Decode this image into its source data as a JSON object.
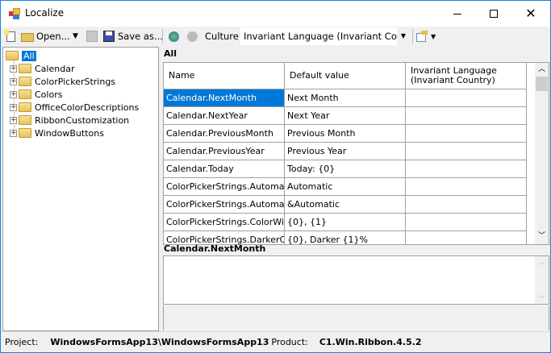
{
  "window": {
    "title": "Localize",
    "controls": [
      "minimize",
      "maximize",
      "close"
    ]
  },
  "toolbar": {
    "open_label": "Open...",
    "save_as_label": "Save as...",
    "culture_label": "Culture",
    "culture_value": "Invariant Language (Invariant Coun"
  },
  "tree": {
    "root": "All",
    "items": [
      "Calendar",
      "ColorPickerStrings",
      "Colors",
      "OfficeColorDescriptions",
      "RibbonCustomization",
      "WindowButtons"
    ]
  },
  "grid": {
    "section_label": "All",
    "headers": [
      "Name",
      "Default value",
      "Invariant Language\n(Invariant Country)"
    ],
    "rows": [
      {
        "name": "Calendar.NextMonth",
        "default": "Next Month",
        "invariant": ""
      },
      {
        "name": "Calendar.NextYear",
        "default": "Next Year",
        "invariant": ""
      },
      {
        "name": "Calendar.PreviousMonth",
        "default": "Previous Month",
        "invariant": ""
      },
      {
        "name": "Calendar.PreviousYear",
        "default": "Previous Year",
        "invariant": ""
      },
      {
        "name": "Calendar.Today",
        "default": "Today: {0}",
        "invariant": ""
      },
      {
        "name": "ColorPickerStrings.Automatic",
        "default": "Automatic",
        "invariant": ""
      },
      {
        "name": "ColorPickerStrings.Automa...",
        "default": "&Automatic",
        "invariant": ""
      },
      {
        "name": "ColorPickerStrings.ColorWi...",
        "default": "{0}, {1}",
        "invariant": ""
      },
      {
        "name": "ColorPickerStrings.DarkerC...",
        "default": "{0}, Darker {1}%",
        "invariant": ""
      }
    ]
  },
  "detail": {
    "key_label": "Calendar.NextMonth",
    "text": ""
  },
  "status": {
    "project_label": "Project:",
    "project_value": "WindowsFormsApp13\\WindowsFormsApp13",
    "product_label": "Product:",
    "product_value": "C1.Win.Ribbon.4.5.2"
  },
  "colors": {
    "selection": "#0078d7",
    "border": "#1883d7"
  }
}
